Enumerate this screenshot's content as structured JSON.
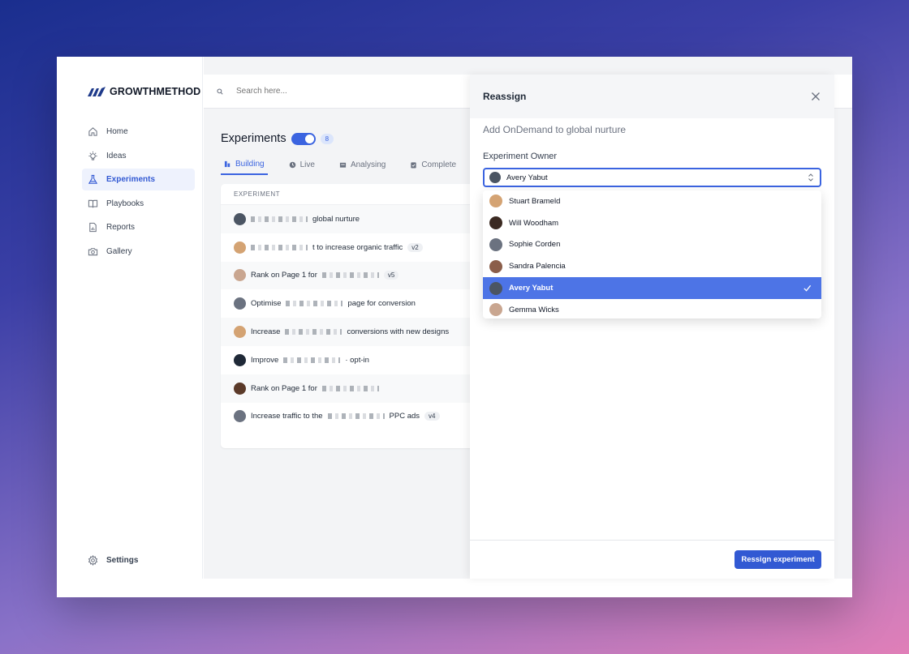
{
  "app": {
    "logo_text": "GROWTHMETHOD",
    "search_placeholder": "Search here..."
  },
  "sidebar": {
    "items": [
      {
        "label": "Home",
        "icon": "home-icon"
      },
      {
        "label": "Ideas",
        "icon": "lightbulb-icon"
      },
      {
        "label": "Experiments",
        "icon": "flask-icon",
        "active": true
      },
      {
        "label": "Playbooks",
        "icon": "book-icon"
      },
      {
        "label": "Reports",
        "icon": "report-icon"
      },
      {
        "label": "Gallery",
        "icon": "camera-icon"
      }
    ],
    "settings_label": "Settings"
  },
  "main": {
    "title": "Experiments",
    "count": "8",
    "tabs": [
      {
        "label": "Building",
        "active": true
      },
      {
        "label": "Live"
      },
      {
        "label": "Analysing"
      },
      {
        "label": "Complete"
      }
    ],
    "table_header": "EXPERIMENT",
    "rows": [
      {
        "prefix": "",
        "suffix": "global nurture",
        "version": "",
        "avatar": "#4b5563"
      },
      {
        "prefix": "",
        "suffix": "t to increase organic traffic",
        "version": "v2",
        "avatar": "#d4a373"
      },
      {
        "prefix": "Rank on Page 1 for",
        "suffix": "",
        "version": "v5",
        "avatar": "#c9a690"
      },
      {
        "prefix": "Optimise",
        "suffix": "page for conversion",
        "version": "",
        "avatar": "#6b7280"
      },
      {
        "prefix": "Increase",
        "suffix": "conversions with new designs",
        "version": "",
        "avatar": "#d4a373"
      },
      {
        "prefix": "Improve",
        "suffix": "· opt-in",
        "version": "",
        "avatar": "#1f2937"
      },
      {
        "prefix": "Rank on Page 1 for",
        "suffix": "",
        "version": "",
        "avatar": "#5b3a29"
      },
      {
        "prefix": "Increase traffic to the",
        "suffix": "PPC ads",
        "version": "v4",
        "avatar": "#6b7280"
      }
    ]
  },
  "panel": {
    "title": "Reassign",
    "subtitle": "Add OnDemand to global nurture",
    "owner_label": "Experiment Owner",
    "selected_owner": "Avery Yabut",
    "options": [
      {
        "name": "Stuart Brameld",
        "avatar": "#d4a373"
      },
      {
        "name": "Will Woodham",
        "avatar": "#3b2a22"
      },
      {
        "name": "Sophie Corden",
        "avatar": "#6b7280"
      },
      {
        "name": "Sandra Palencia",
        "avatar": "#8b5e4a"
      },
      {
        "name": "Avery Yabut",
        "avatar": "#4b5563",
        "selected": true
      },
      {
        "name": "Gemma Wicks",
        "avatar": "#c9a690"
      }
    ],
    "submit_label": "Ressign experiment"
  },
  "colors": {
    "accent": "#3259d3",
    "selected_option": "#4d74e6"
  }
}
